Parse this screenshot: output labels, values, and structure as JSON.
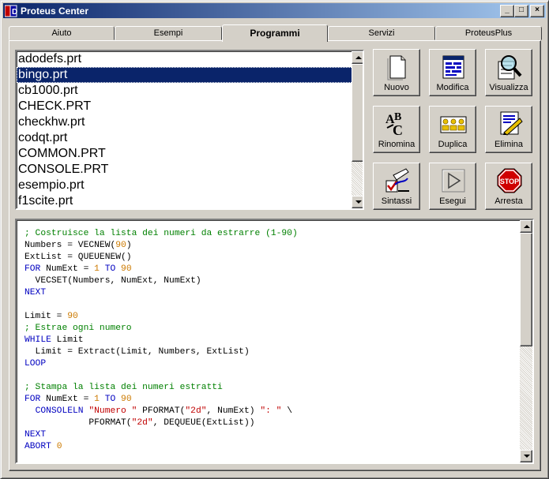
{
  "window": {
    "title": "Proteus Center",
    "minimize": "_",
    "maximize": "□",
    "close": "×"
  },
  "tabs": [
    {
      "label": "Aiuto",
      "active": false
    },
    {
      "label": "Esempi",
      "active": false
    },
    {
      "label": "Programmi",
      "active": true
    },
    {
      "label": "Servizi",
      "active": false
    },
    {
      "label": "ProteusPlus",
      "active": false
    }
  ],
  "files": [
    "adodefs.prt",
    "bingo.prt",
    "cb1000.prt",
    "CHECK.PRT",
    "checkhw.prt",
    "codqt.prt",
    "COMMON.PRT",
    "CONSOLE.PRT",
    "esempio.prt",
    "f1scite.prt"
  ],
  "selected_file": "bingo.prt",
  "toolbar": [
    {
      "label": "Nuovo",
      "icon": "new-document-icon"
    },
    {
      "label": "Modifica",
      "icon": "edit-document-icon"
    },
    {
      "label": "Visualizza",
      "icon": "magnifier-icon"
    },
    {
      "label": "Rinomina",
      "icon": "rename-abc-icon"
    },
    {
      "label": "Duplica",
      "icon": "duplicate-people-icon"
    },
    {
      "label": "Elimina",
      "icon": "delete-document-icon"
    },
    {
      "label": "Sintassi",
      "icon": "syntax-check-icon"
    },
    {
      "label": "Esegui",
      "icon": "play-icon"
    },
    {
      "label": "Arresta",
      "icon": "stop-sign-icon"
    }
  ],
  "code_lines": [
    [
      {
        "t": "c",
        "v": "; Costruisce la lista dei numeri da estrarre (1-90)"
      }
    ],
    [
      {
        "t": "",
        "v": "Numbers = VECNEW("
      },
      {
        "t": "n",
        "v": "90"
      },
      {
        "t": "",
        "v": ")"
      }
    ],
    [
      {
        "t": "",
        "v": "ExtList = QUEUENEW()"
      }
    ],
    [
      {
        "t": "k",
        "v": "FOR"
      },
      {
        "t": "",
        "v": " NumExt = "
      },
      {
        "t": "n",
        "v": "1"
      },
      {
        "t": "",
        "v": " "
      },
      {
        "t": "k",
        "v": "TO"
      },
      {
        "t": "",
        "v": " "
      },
      {
        "t": "n",
        "v": "90"
      }
    ],
    [
      {
        "t": "",
        "v": "  VECSET(Numbers, NumExt, NumExt)"
      }
    ],
    [
      {
        "t": "k",
        "v": "NEXT"
      }
    ],
    [
      {
        "t": "",
        "v": ""
      }
    ],
    [
      {
        "t": "",
        "v": "Limit = "
      },
      {
        "t": "n",
        "v": "90"
      }
    ],
    [
      {
        "t": "c",
        "v": "; Estrae ogni numero"
      }
    ],
    [
      {
        "t": "k",
        "v": "WHILE"
      },
      {
        "t": "",
        "v": " Limit"
      }
    ],
    [
      {
        "t": "",
        "v": "  Limit = Extract(Limit, Numbers, ExtList)"
      }
    ],
    [
      {
        "t": "k",
        "v": "LOOP"
      }
    ],
    [
      {
        "t": "",
        "v": ""
      }
    ],
    [
      {
        "t": "c",
        "v": "; Stampa la lista dei numeri estratti"
      }
    ],
    [
      {
        "t": "k",
        "v": "FOR"
      },
      {
        "t": "",
        "v": " NumExt = "
      },
      {
        "t": "n",
        "v": "1"
      },
      {
        "t": "",
        "v": " "
      },
      {
        "t": "k",
        "v": "TO"
      },
      {
        "t": "",
        "v": " "
      },
      {
        "t": "n",
        "v": "90"
      }
    ],
    [
      {
        "t": "",
        "v": "  "
      },
      {
        "t": "k",
        "v": "CONSOLELN"
      },
      {
        "t": "",
        "v": " "
      },
      {
        "t": "s",
        "v": "\"Numero \""
      },
      {
        "t": "",
        "v": " PFORMAT("
      },
      {
        "t": "s",
        "v": "\"2d\""
      },
      {
        "t": "",
        "v": ", NumExt) "
      },
      {
        "t": "s",
        "v": "\": \""
      },
      {
        "t": "",
        "v": " \\"
      }
    ],
    [
      {
        "t": "",
        "v": "            PFORMAT("
      },
      {
        "t": "s",
        "v": "\"2d\""
      },
      {
        "t": "",
        "v": ", DEQUEUE(ExtList))"
      }
    ],
    [
      {
        "t": "k",
        "v": "NEXT"
      }
    ],
    [
      {
        "t": "k",
        "v": "ABORT"
      },
      {
        "t": "",
        "v": " "
      },
      {
        "t": "n",
        "v": "0"
      }
    ]
  ]
}
